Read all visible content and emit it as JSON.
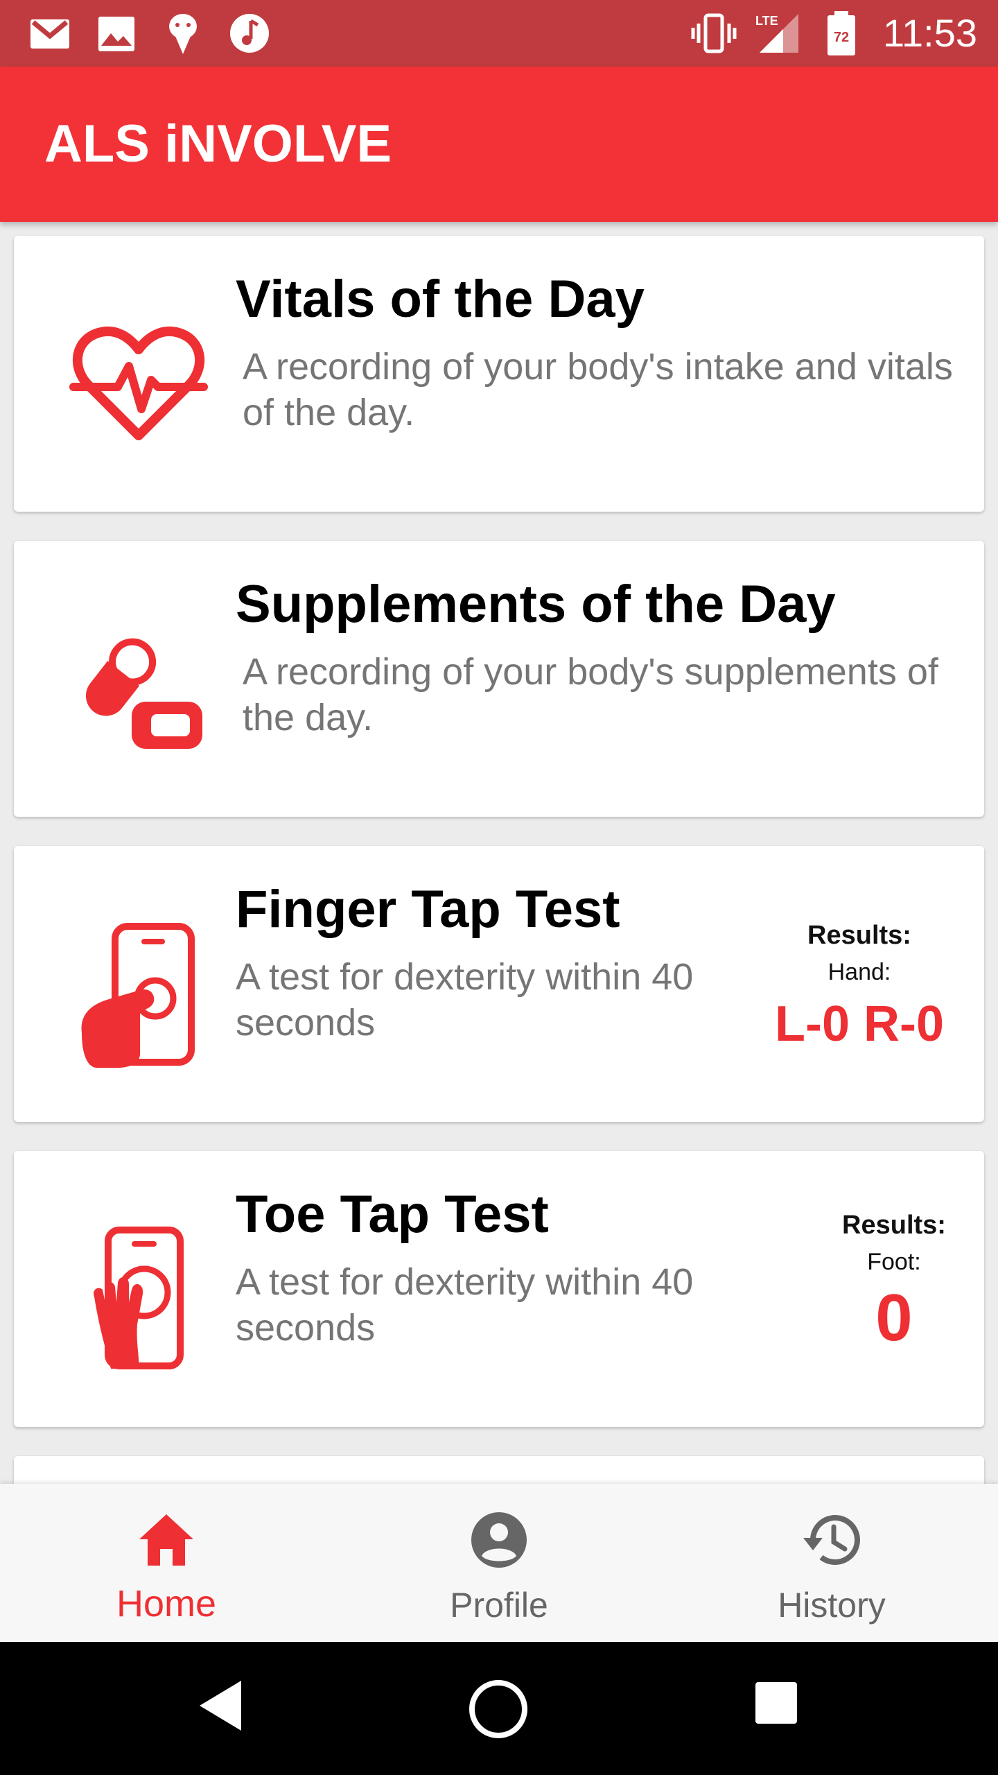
{
  "status_bar": {
    "time": "11:53",
    "battery_level": "72",
    "network": "LTE",
    "icons": [
      "gmail-icon",
      "image-icon",
      "app-icon",
      "music-icon",
      "vibrate-icon",
      "signal-icon",
      "battery-icon"
    ]
  },
  "app_bar": {
    "title": "ALS iNVOLVE"
  },
  "cards": [
    {
      "title": "Vitals of the Day",
      "description": "A recording of your body's intake and vitals of the day.",
      "icon": "heartbeat-icon"
    },
    {
      "title": "Supplements of the Day",
      "description": "A recording of your body's supplements of the day.",
      "icon": "pill-icon"
    },
    {
      "title": "Finger Tap Test",
      "description": "A test for dexterity within 40 seconds",
      "icon": "finger-tap-icon",
      "results_label": "Results:",
      "results_sub": "Hand:",
      "results_value": "L-0 R-0"
    },
    {
      "title": "Toe Tap Test",
      "description": "A test for dexterity within 40 seconds",
      "icon": "toe-tap-icon",
      "results_label": "Results:",
      "results_sub": "Foot:",
      "results_value": "0"
    }
  ],
  "bottom_nav": {
    "items": [
      {
        "label": "Home",
        "icon": "home-icon",
        "active": true
      },
      {
        "label": "Profile",
        "icon": "profile-icon",
        "active": false
      },
      {
        "label": "History",
        "icon": "history-icon",
        "active": false
      }
    ]
  },
  "colors": {
    "status_bar": "#c03b3f",
    "app_bar": "#f23236",
    "accent": "#ee2f33",
    "secondary_text": "#757575"
  }
}
